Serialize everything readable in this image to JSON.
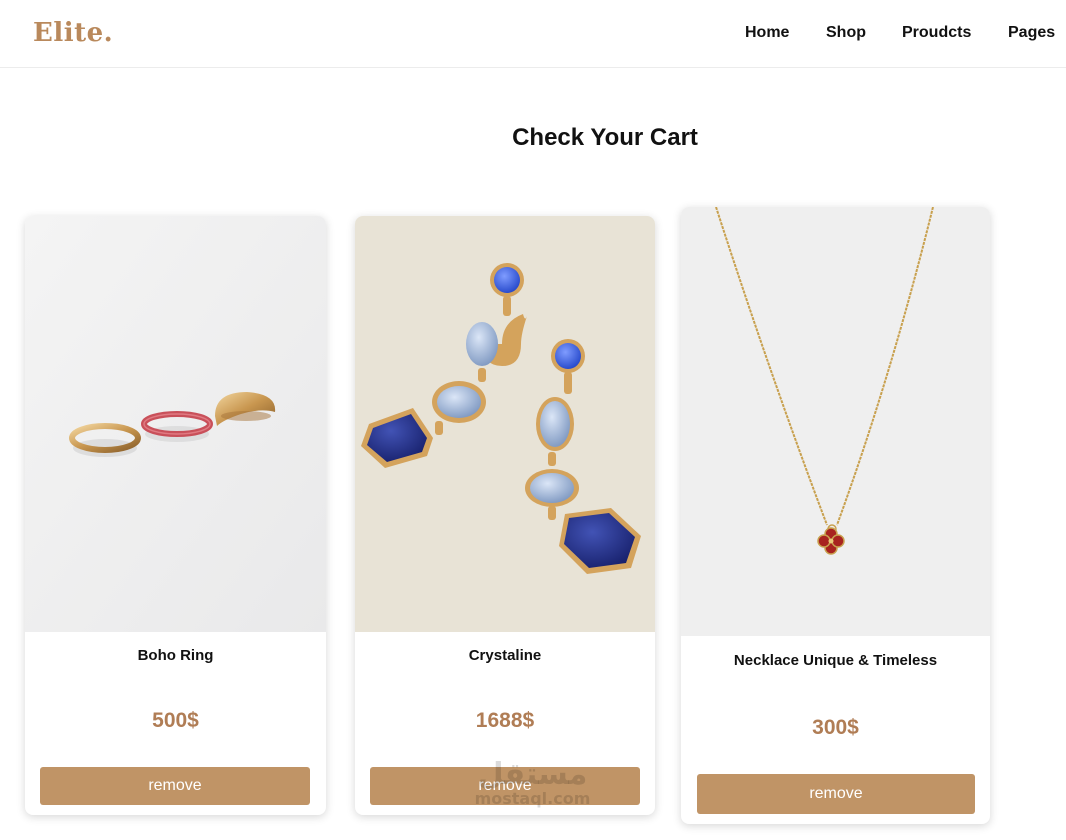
{
  "header": {
    "logo": "Elite.",
    "nav": [
      "Home",
      "Shop",
      "Proudcts",
      "Pages"
    ]
  },
  "page": {
    "title": "Check Your Cart"
  },
  "cart": {
    "items": [
      {
        "name": "Boho Ring",
        "price": "500$",
        "button": "remove",
        "image_icon": "rings-image"
      },
      {
        "name": "Crystaline",
        "price": "1688$",
        "button": "remove",
        "image_icon": "earrings-image"
      },
      {
        "name": "Necklace Unique & Timeless",
        "price": "300$",
        "button": "remove",
        "image_icon": "necklace-image"
      }
    ]
  },
  "watermark": {
    "arabic": "مستقل",
    "latin": "mostaql.com"
  },
  "colors": {
    "accent": "#c09466",
    "logo": "#b9895c",
    "price": "#b07d55"
  }
}
